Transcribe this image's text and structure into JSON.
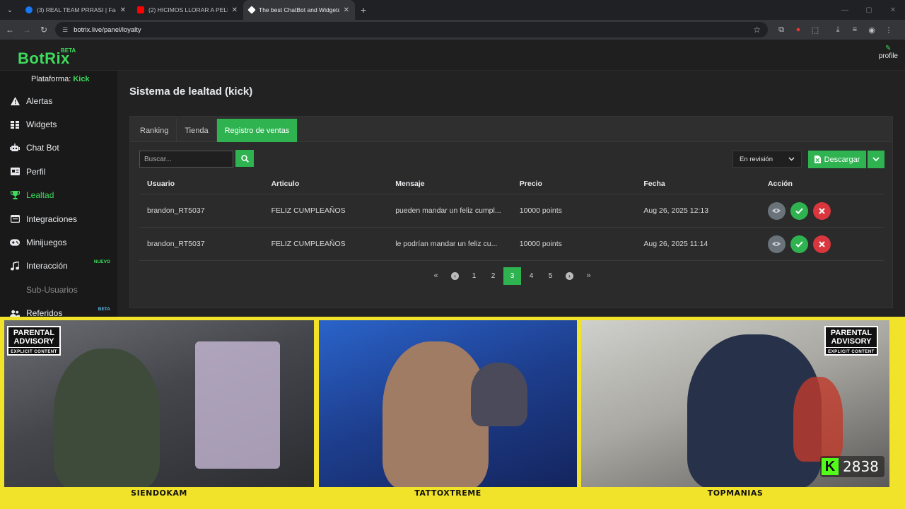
{
  "browser": {
    "tabs": [
      {
        "title": "(3) REAL TEAM PRRASI | Facebook",
        "favicon_color": "#1877f2"
      },
      {
        "title": "(2) HICIMOS LLORAR A PELICAN",
        "favicon_color": "#ff0000"
      },
      {
        "title": "The best ChatBot and Widgets",
        "favicon_color": "#ffffff"
      }
    ],
    "url": "botrix.live/panel/loyalty"
  },
  "app": {
    "logo": "BotRix",
    "logo_badge": "BETA",
    "profile_label": "profile",
    "platform_label": "Plataforma:",
    "platform_value": "Kick",
    "accent": "#2eb350"
  },
  "sidebar": {
    "items": [
      {
        "label": "Alertas",
        "icon": "warning-icon"
      },
      {
        "label": "Widgets",
        "icon": "grid-icon"
      },
      {
        "label": "Chat Bot",
        "icon": "robot-icon"
      },
      {
        "label": "Perfil",
        "icon": "id-card-icon"
      },
      {
        "label": "Lealtad",
        "icon": "trophy-icon"
      },
      {
        "label": "Integraciones",
        "icon": "window-icon"
      },
      {
        "label": "Minijuegos",
        "icon": "gamepad-icon"
      },
      {
        "label": "Interacción",
        "icon": "music-icon",
        "badge": "NUEVO"
      },
      {
        "label": "Sub-Usuarios",
        "icon": ""
      },
      {
        "label": "Referidos",
        "icon": "users-icon",
        "badge": "BETA"
      }
    ]
  },
  "page": {
    "title": "Sistema de lealtad (kick)",
    "tabs": [
      "Ranking",
      "Tienda",
      "Registro de ventas"
    ],
    "search_placeholder": "Buscar...",
    "filter_value": "En revisión",
    "download_label": "Descargar"
  },
  "table": {
    "headers": [
      "Usuario",
      "Articulo",
      "Mensaje",
      "Precio",
      "Fecha",
      "Acción"
    ],
    "rows": [
      {
        "usuario": "brandon_RT5037",
        "articulo": "FELIZ CUMPLEAÑOS",
        "mensaje": "pueden mandar un feliz cumpl...",
        "precio": "10000 points",
        "fecha": "Aug 26, 2025 12:13"
      },
      {
        "usuario": "brandon_RT5037",
        "articulo": "FELIZ CUMPLEAÑOS",
        "mensaje": "le podrían mandar un feliz cu...",
        "precio": "10000 points",
        "fecha": "Aug 26, 2025 11:14"
      }
    ]
  },
  "pagination": {
    "pages": [
      "1",
      "2",
      "3",
      "4",
      "5"
    ],
    "current": "3"
  },
  "stream": {
    "cams": [
      {
        "name": "SIENDOKAM"
      },
      {
        "name": "TATTOXTREME"
      },
      {
        "name": "TOPMANIAS"
      }
    ],
    "parental_title": "PARENTAL ADVISORY",
    "parental_sub": "EXPLICIT CONTENT",
    "viewers_logo": "K",
    "viewer_count": "2838"
  }
}
